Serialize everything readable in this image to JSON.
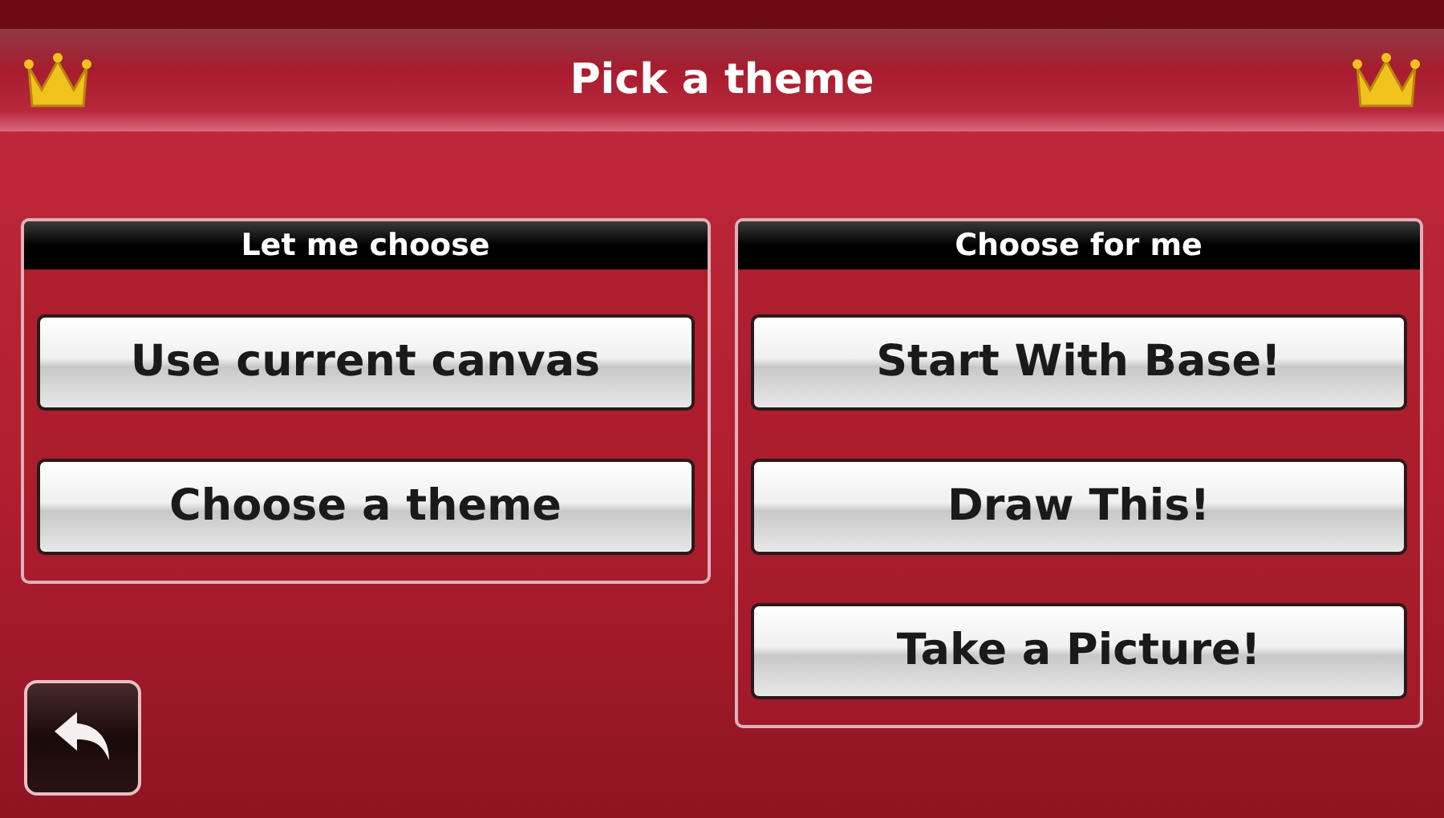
{
  "header": {
    "title": "Pick a theme"
  },
  "panels": [
    {
      "title": "Let me choose",
      "buttons": [
        "Use current canvas",
        "Choose a theme"
      ]
    },
    {
      "title": "Choose for me",
      "buttons": [
        "Start With Base!",
        "Draw This!",
        "Take a Picture!"
      ]
    }
  ]
}
